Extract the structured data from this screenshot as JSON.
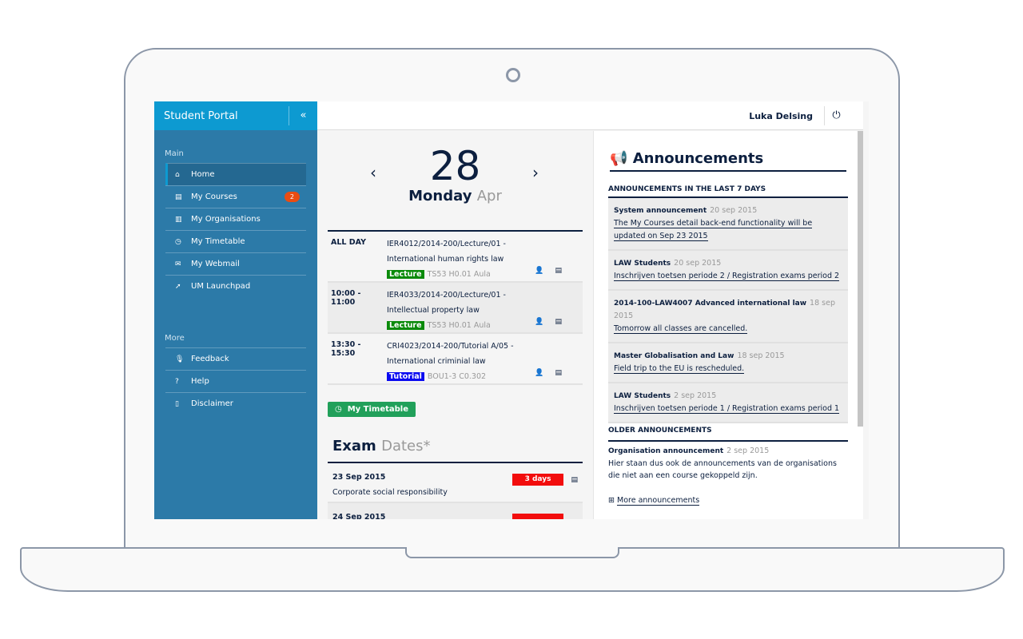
{
  "sidebar": {
    "title": "Student Portal",
    "collapse_icon": "«",
    "section_main": "Main",
    "section_more": "More",
    "main_items": [
      {
        "label": "Home",
        "icon": "home"
      },
      {
        "label": "My Courses",
        "icon": "book",
        "badge": "2"
      },
      {
        "label": "My Organisations",
        "icon": "bank"
      },
      {
        "label": "My Timetable",
        "icon": "clock"
      },
      {
        "label": "My Webmail",
        "icon": "envelope"
      },
      {
        "label": "UM Launchpad",
        "icon": "rocket"
      }
    ],
    "more_items": [
      {
        "label": "Feedback",
        "icon": "microphone"
      },
      {
        "label": "Help",
        "icon": "question"
      },
      {
        "label": "Disclaimer",
        "icon": "document"
      }
    ]
  },
  "header": {
    "user": "Luka Delsing"
  },
  "calendar": {
    "day": "28",
    "weekday": "Monday",
    "month": "Apr",
    "events": [
      {
        "time": "ALL DAY",
        "title": "IER4012/2014-200/Lecture/01 - International human rights law",
        "type": "Lecture",
        "type_color": "#0a8a0a",
        "location": "TS53 H0.01 Aula"
      },
      {
        "time": "10:00 - 11:00",
        "title": "IER4033/2014-200/Lecture/01 - Intellectual property law",
        "type": "Lecture",
        "type_color": "#0a8a0a",
        "location": "TS53 H0.01 Aula"
      },
      {
        "time": "13:30 - 15:30",
        "title": "CRI4023/2014-200/Tutorial A/05 - International criminial law",
        "type": "Tutorial",
        "type_color": "#0a0af0",
        "location": "BOU1-3 C0.302"
      }
    ],
    "timetable_button": "My Timetable"
  },
  "exams": {
    "title_bold": "Exam",
    "title_light": "Dates*",
    "items": [
      {
        "date": "23 Sep 2015",
        "course": "Corporate social responsibility",
        "countdown": "3 days"
      },
      {
        "date": "24 Sep 2015",
        "course": "",
        "countdown": ""
      }
    ]
  },
  "announcements": {
    "title": "Announcements",
    "recent_header": "ANNOUNCEMENTS IN THE LAST 7 DAYS",
    "recent": [
      {
        "source": "System announcement",
        "date": "20 sep 2015",
        "text": "The My Courses detail back-end functionality will be updated on Sep 23 2015"
      },
      {
        "source": "LAW Students",
        "date": "20 sep 2015",
        "text": "Inschrijven toetsen periode 2 / Registration exams period 2"
      },
      {
        "source": "2014-100-LAW4007 Advanced international law",
        "date": "18 sep 2015",
        "text": "Tomorrow all classes are cancelled."
      },
      {
        "source": "Master Globalisation and Law",
        "date": "18 sep 2015",
        "text": "Field trip to the EU is rescheduled."
      },
      {
        "source": "LAW Students",
        "date": "2 sep 2015",
        "text": "Inschrijven toetsen periode 1 / Registration exams period 1"
      }
    ],
    "older_header": "OLDER ANNOUNCEMENTS",
    "older": [
      {
        "source": "Organisation announcement",
        "date": "2 sep 2015",
        "text": "Hier staan dus ook de announcements van de organisations die niet aan een course gekoppeld zijn."
      }
    ],
    "more_link": "More announcements"
  }
}
